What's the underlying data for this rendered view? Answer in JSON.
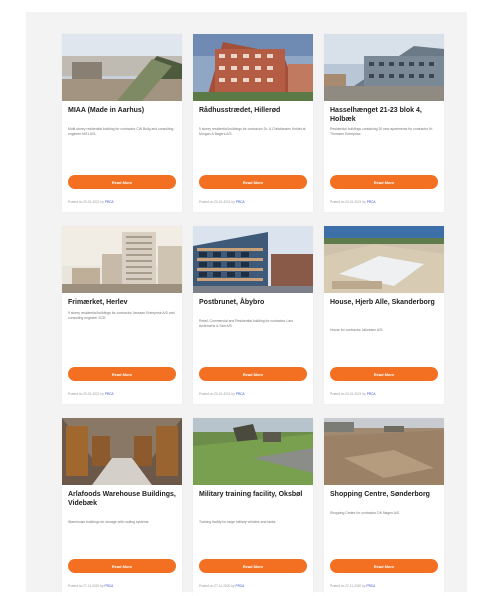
{
  "cards": [
    {
      "title": "MIAA (Made in Aarhus)",
      "desc": "Multi-storey residential building for contractor CW Bolig and consulting engineer MS1 A/S.",
      "button": "Read More",
      "posted": "Posted on 20-01-2021 by",
      "author": "PRCA"
    },
    {
      "title": "Rådhusstrædet, Hillerød",
      "desc": "5 storey residential buildings for contractor Dr. & Christiansen Holdet at Morgan & Bagers A/S",
      "button": "Read More",
      "posted": "Posted on 20-01-2021 by",
      "author": "PRCA"
    },
    {
      "title": "Hasselhænget 21-23 blok 4, Holbæk",
      "desc": "Residential buildings containing 30 new apartments for contractor Kr. Thomsen Entreprise.",
      "button": "Read More",
      "posted": "Posted on 20-01-2021 by",
      "author": "PRCA"
    },
    {
      "title": "Frimærket, Herlev",
      "desc": "9 storey residential buildings for contractor Jenssen Entreprise A/S and consulting engineer SCR.",
      "button": "Read More",
      "posted": "Posted on 20-01-2021 by",
      "author": "PRCA"
    },
    {
      "title": "Postbrunet, Åbybro",
      "desc": "Retail, Commercial and Residential building for contractor Lars Andersens & Søn A/S.",
      "button": "Read More",
      "posted": "Posted on 20-01-2021 by",
      "author": "PRCA"
    },
    {
      "title": "House, Hjerb Alle, Skanderborg",
      "desc": "House for contractor Jakobsen A/S.",
      "button": "Read More",
      "posted": "Posted on 20-01-2021 by",
      "author": "PRCA"
    },
    {
      "title": "Arlafoods Warehouse Buildings, Videbæk",
      "desc": "Warehouse buildings for storage with roofing systems.",
      "button": "Read More",
      "posted": "Posted on 27-11-2020 by",
      "author": "PRCA"
    },
    {
      "title": "Military training facility, Oksbøl",
      "desc": "Training facility for large military vehicles and tanks.",
      "button": "Read More",
      "posted": "Posted on 27-11-2020 by",
      "author": "PRCA"
    },
    {
      "title": "Shopping Centre, Sønderborg",
      "desc": "Shopping Centre for contractor DK Nagen A/S.",
      "button": "Read More",
      "posted": "Posted on 27-11-2020 by",
      "author": "PRCA"
    }
  ],
  "colors": {
    "button": "#f36f21",
    "author_link": "#3a55c7"
  }
}
